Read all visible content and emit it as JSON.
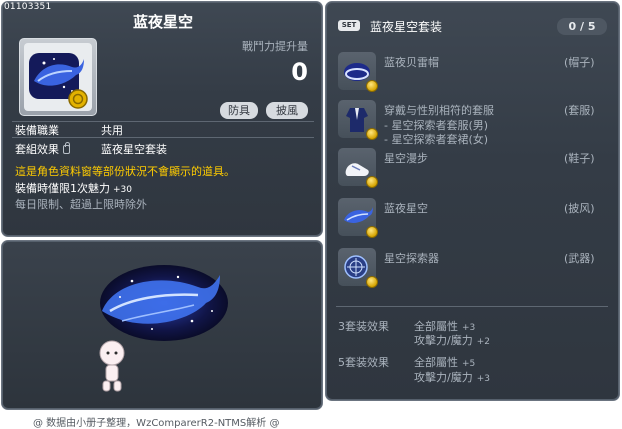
{
  "item": {
    "id": "01103351",
    "name": "蓝夜星空",
    "power_label": "戰鬥力提升量",
    "power_value": "0",
    "tags": [
      "防具",
      "披風"
    ],
    "job_label": "裝備職業",
    "job_value": "共用",
    "set_label": "套組效果",
    "set_value": "蓝夜星空套装",
    "warning": "這是角色資料窗等部份狀況不會顯示的道具。",
    "limit_text": "裝備時僅限1次魅力",
    "limit_sub": "+30",
    "limit_note": "每日限制、超過上限時除外"
  },
  "set": {
    "badge": "SET",
    "title": "蓝夜星空套装",
    "count": "0 / 5",
    "parts": [
      {
        "name": "蓝夜贝雷帽",
        "type": "(帽子)",
        "icon": "beret-icon",
        "sub": []
      },
      {
        "name": "穿戴与性别相符的套服",
        "type": "(套服)",
        "icon": "outfit-icon",
        "sub": [
          "- 星空探索者套服(男)",
          "- 星空探索者套裙(女)"
        ]
      },
      {
        "name": "星空漫步",
        "type": "(鞋子)",
        "icon": "shoes-icon",
        "sub": []
      },
      {
        "name": "蓝夜星空",
        "type": "(披风)",
        "icon": "whale-cape-icon",
        "sub": []
      },
      {
        "name": "星空探索器",
        "type": "(武器)",
        "icon": "explorer-device-icon",
        "sub": []
      }
    ],
    "bonuses": [
      {
        "label": "3套装效果",
        "lines": [
          {
            "text": "全部屬性",
            "num": "+3"
          },
          {
            "text": "攻擊力/魔力",
            "num": "+2"
          }
        ]
      },
      {
        "label": "5套装效果",
        "lines": [
          {
            "text": "全部屬性",
            "num": "+5"
          },
          {
            "text": "攻擊力/魔力",
            "num": "+3"
          }
        ]
      }
    ]
  },
  "footer": "@ 数据由小册子整理，WzComparerR2-NTMS解析 @",
  "colors": {
    "panel": "#343c46",
    "warning": "#ffcc00",
    "muted": "#aab3bd",
    "coin": "#d6a400"
  }
}
